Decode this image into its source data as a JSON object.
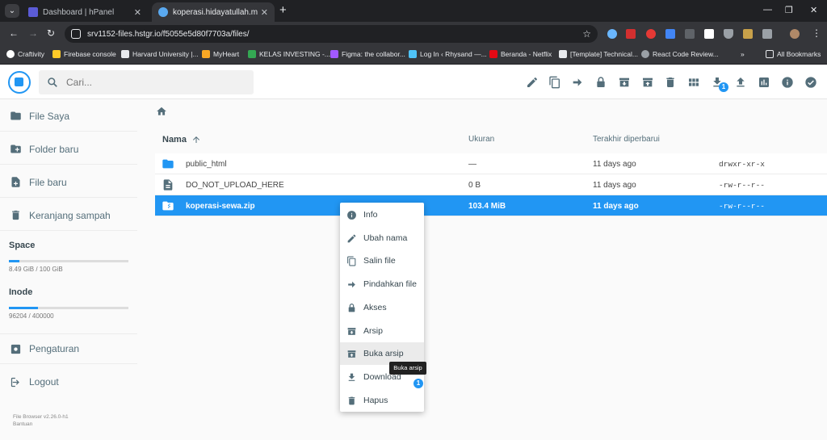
{
  "browser": {
    "tabs": [
      {
        "title": "Dashboard | hPanel",
        "active": false
      },
      {
        "title": "koperasi.hidayatullah.me - kop",
        "active": true
      }
    ],
    "url": "srv1152-files.hstgr.io/f5055e5d80f7703a/files/",
    "bookmarks": [
      "Craftivity",
      "Firebase console",
      "Harvard University |...",
      "MyHeart",
      "KELAS INVESTING -...",
      "Figma: the collabor...",
      "Log In ‹ Rhysand —...",
      "Beranda - Netflix",
      "[Template] Technical...",
      "React Code Review..."
    ],
    "all_bookmarks": "All Bookmarks"
  },
  "app": {
    "search_placeholder": "Cari...",
    "download_badge": "1"
  },
  "sidebar": {
    "items": [
      "File Saya",
      "Folder baru",
      "File baru",
      "Keranjang sampah"
    ],
    "space_title": "Space",
    "space_usage": "8.49 GiB / 100 GiB",
    "space_fraction": 0.085,
    "inode_title": "Inode",
    "inode_usage": "96204 / 400000",
    "inode_fraction": 0.24,
    "settings": "Pengaturan",
    "logout": "Logout",
    "version": "File Browser v2.26.0-h1",
    "help": "Bantuan"
  },
  "files": {
    "headers": {
      "name": "Nama",
      "size": "Ukuran",
      "modified": "Terakhir diperbarui"
    },
    "rows": [
      {
        "name": "public_html",
        "size": "—",
        "modified": "11 days ago",
        "perm": "drwxr-xr-x",
        "type": "folder"
      },
      {
        "name": "DO_NOT_UPLOAD_HERE",
        "size": "0 B",
        "modified": "11 days ago",
        "perm": "-rw-r--r--",
        "type": "file"
      },
      {
        "name": "koperasi-sewa.zip",
        "size": "103.4 MiB",
        "modified": "11 days ago",
        "perm": "-rw-r--r--",
        "type": "archive"
      }
    ]
  },
  "context_menu": {
    "items": [
      "Info",
      "Ubah nama",
      "Salin file",
      "Pindahkan file",
      "Akses",
      "Arsip",
      "Buka arsip",
      "Download",
      "Hapus"
    ],
    "tooltip": "Buka arsip",
    "download_badge": "1"
  },
  "colors": {
    "accent": "#2196f3",
    "sidebar_text": "#546e7a"
  }
}
